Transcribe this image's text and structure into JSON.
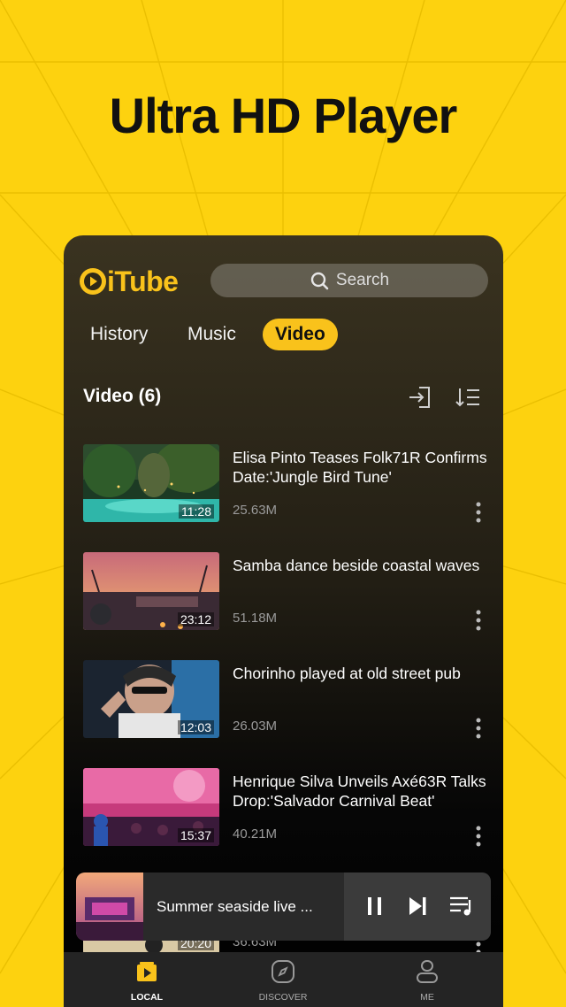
{
  "headline": "Ultra HD Player",
  "app": {
    "logo_text": "iTube",
    "brand_color": "#f9c21b"
  },
  "search": {
    "placeholder": "Search",
    "icon": "search-icon"
  },
  "tabs": [
    {
      "label": "History",
      "active": false
    },
    {
      "label": "Music",
      "active": false
    },
    {
      "label": "Video",
      "active": true
    }
  ],
  "section": {
    "title": "Video (6)",
    "icons": [
      "import-icon",
      "sort-icon"
    ]
  },
  "videos": [
    {
      "title": "Elisa Pinto Teases Folk71R Confirms Date:'Jungle Bird Tune'",
      "duration": "11:28",
      "size": "25.63M"
    },
    {
      "title": "Samba dance beside coastal waves",
      "duration": "23:12",
      "size": "51.18M"
    },
    {
      "title": "Chorinho played at old street pub",
      "duration": "12:03",
      "size": "26.03M"
    },
    {
      "title": "Henrique Silva Unveils Axé63R Talks Drop:'Salvador Carnival Beat'",
      "duration": "15:37",
      "size": "40.21M"
    },
    {
      "title": "",
      "duration": "20:20",
      "size": "36.63M"
    }
  ],
  "now_playing": {
    "title": "Summer seaside live ...",
    "controls": [
      "pause-icon",
      "next-icon",
      "playlist-icon"
    ]
  },
  "bottom_nav": [
    {
      "label": "LOCAL",
      "icon": "local-icon",
      "active": true
    },
    {
      "label": "DISCOVER",
      "icon": "compass-icon",
      "active": false
    },
    {
      "label": "ME",
      "icon": "profile-icon",
      "active": false
    }
  ]
}
